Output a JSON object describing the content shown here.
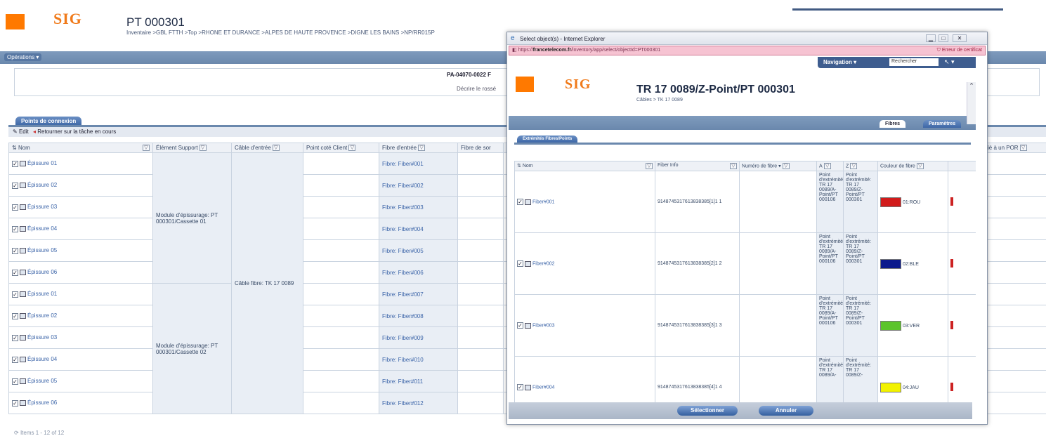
{
  "header": {
    "title": "PT 000301",
    "breadcrumb": "Inventaire >GBL FTTH >Top >RHONE ET DURANCE >ALPES DE HAUTE PROVENCE >DIGNE LES BAINS >NP/RR015P"
  },
  "logo_text": "SIG",
  "ops_bar": {
    "label": "Opérations"
  },
  "info": {
    "ref": "PA-04070-0022 F",
    "desc": "Décrire le rossé"
  },
  "points_tab": "Points de connexion",
  "toolbar": {
    "edit": "Edit",
    "back": "Retourner sur la tâche en cours"
  },
  "columns": [
    "Nom",
    "Élément Support",
    "Câble d'entrée",
    "Point coté Client",
    "Fibre d'entrée",
    "Fibre de sor",
    "Relié à un POR"
  ],
  "rows": [
    {
      "nom": "Épissure 01",
      "fibre": "Fibre: Fiber#001"
    },
    {
      "nom": "Épissure 02",
      "fibre": "Fibre: Fiber#002"
    },
    {
      "nom": "Épissure 03",
      "fibre": "Fibre: Fiber#003"
    },
    {
      "nom": "Épissure 04",
      "fibre": "Fibre: Fiber#004"
    },
    {
      "nom": "Épissure 05",
      "fibre": "Fibre: Fiber#005"
    },
    {
      "nom": "Épissure 06",
      "fibre": "Fibre: Fiber#006"
    },
    {
      "nom": "Épissure 01",
      "fibre": "Fibre: Fiber#007"
    },
    {
      "nom": "Épissure 02",
      "fibre": "Fibre: Fiber#008"
    },
    {
      "nom": "Épissure 03",
      "fibre": "Fibre: Fiber#009"
    },
    {
      "nom": "Épissure 04",
      "fibre": "Fibre: Fiber#010"
    },
    {
      "nom": "Épissure 05",
      "fibre": "Fibre: Fiber#011"
    },
    {
      "nom": "Épissure 06",
      "fibre": "Fibre: Fiber#012"
    }
  ],
  "support_1": "Module d'épissurage: PT 000301/Cassette 01",
  "support_2": "Module d'épissurage: PT 000301/Cassette 02",
  "cable_in": "Câble fibre: TK 17 0089",
  "pager": "Items 1 - 12 of 12",
  "popup": {
    "window_title": "Select object(s) - Internet Explorer",
    "url_prefix": "https://",
    "url_domain": "francetelecom.fr",
    "url_tail": "/inventory/app/select/objectId=PT000301",
    "url_warning": "Erreur de certificat",
    "nav_label": "Navigation",
    "search_placeholder": "Rechercher",
    "title": "TR 17 0089/Z-Point/PT 000301",
    "sub": "Câbles > TK 17 0089",
    "tab_fibres": "Fibres",
    "tab_params": "Paramètres",
    "list_tab": "Extrémités Fibres/Points",
    "columns": [
      "Nom",
      "Fiber Info",
      "Numéro de fibre",
      "A",
      "Z",
      "Couleur de fibre"
    ],
    "rows": [
      {
        "nom": "Fiber#001",
        "info": "9148745317613838385[1]1",
        "num": "1",
        "a": "Point d'extrémité: TR 17 0089/A-Point/PT 000106",
        "z": "Point d'extrémité: TR 17 0089/Z-Point/PT 000301",
        "color": "#d11b1b",
        "color_label": "01:ROU"
      },
      {
        "nom": "Fiber#002",
        "info": "9148745317613838385[2]1",
        "num": "2",
        "a": "Point d'extrémité: TR 17 0089/A-Point/PT 000106",
        "z": "Point d'extrémité: TR 17 0089/Z-Point/PT 000301",
        "color": "#0c1a8c",
        "color_label": "02:BLE"
      },
      {
        "nom": "Fiber#003",
        "info": "9148745317613838385[3]1",
        "num": "3",
        "a": "Point d'extrémité: TR 17 0089/A-Point/PT 000106",
        "z": "Point d'extrémité: TR 17 0089/Z-Point/PT 000301",
        "color": "#5cc42b",
        "color_label": "03:VER"
      },
      {
        "nom": "Fiber#004",
        "info": "9148745317613838385[4]1",
        "num": "4",
        "a": "Point d'extrémité: TR 17 0089/A-",
        "z": "Point d'extrémité: TR 17 0089/Z-",
        "color": "#f2f200",
        "color_label": "04:JAU"
      }
    ],
    "btn_select": "Sélectionner",
    "btn_cancel": "Annuler"
  }
}
